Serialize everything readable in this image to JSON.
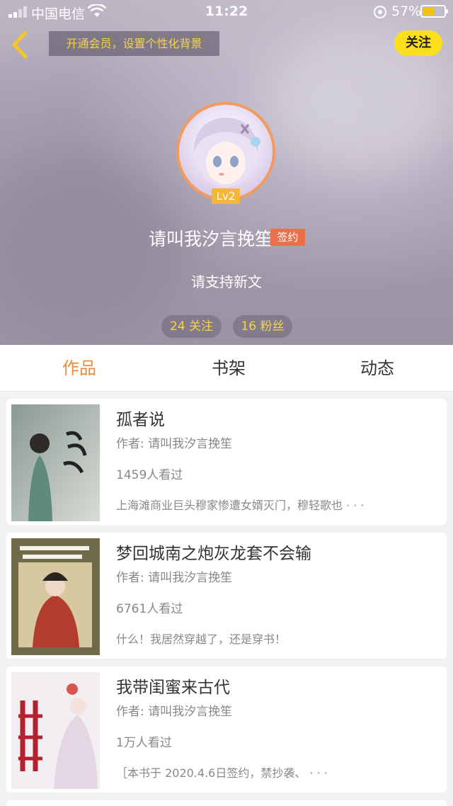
{
  "status_bar": {
    "carrier": "中国电信",
    "time": "11:22",
    "battery": "57%",
    "battery_level": 0.57
  },
  "header": {
    "back_icon": "chevron-left-icon",
    "vip_banner": "开通会员，设置个性化背景",
    "follow_label": "关注",
    "level": "Lv2",
    "nickname": "请叫我汐言挽笙",
    "signed_badge": "签约",
    "signature": "请支持新文",
    "following": "24 关注",
    "fans": "16 粉丝"
  },
  "tabs": [
    {
      "label": "作品",
      "active": true
    },
    {
      "label": "书架",
      "active": false
    },
    {
      "label": "动态",
      "active": false
    }
  ],
  "books": [
    {
      "title": "孤者说",
      "author": "作者: 请叫我汐言挽笙",
      "views": "1459人看过",
      "desc": "上海滩商业巨头穆家惨遭女婿灭门，穆轻歌也 · · ·"
    },
    {
      "title": "梦回城南之炮灰龙套不会输",
      "author": "作者: 请叫我汐言挽笙",
      "views": "6761人看过",
      "desc": "什么！我居然穿越了，还是穿书！"
    },
    {
      "title": "我带闺蜜来古代",
      "author": "作者: 请叫我汐言挽笙",
      "views": "1万人看过",
      "desc": "［本书于 2020.4.6日签约，禁抄袭、 · · ·"
    }
  ],
  "colors": {
    "accent": "#f08a3c",
    "follow_button": "#fadf1a",
    "banner_text": "#f6d34a",
    "signed_badge": "#e8704a",
    "level_badge": "#f6b638"
  }
}
